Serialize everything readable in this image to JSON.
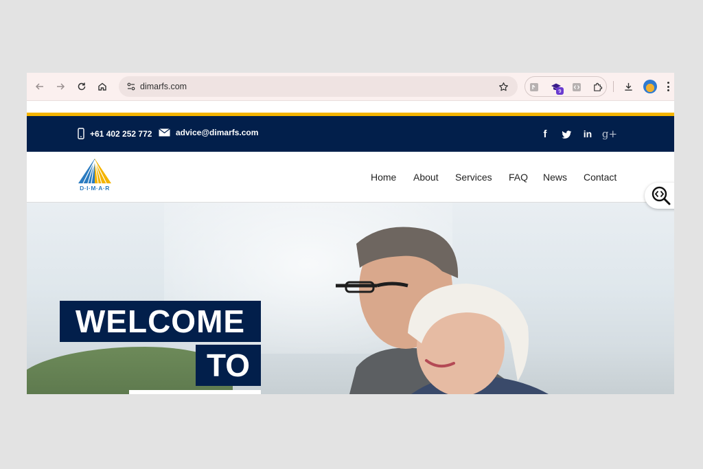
{
  "browser": {
    "url": "dimarfs.com",
    "extension_badge": "9"
  },
  "site": {
    "topbar": {
      "phone": "+61 402 252 772",
      "email": "advice@dimarfs.com",
      "social": [
        {
          "icon": "facebook-icon",
          "glyph": "f"
        },
        {
          "icon": "twitter-icon"
        },
        {
          "icon": "linkedin-icon",
          "glyph": "in"
        },
        {
          "icon": "google-plus-icon",
          "glyph": "g+"
        }
      ]
    },
    "logo_text": "D·I·M·A·R",
    "nav": [
      "Home",
      "About",
      "Services",
      "FAQ",
      "News",
      "Contact"
    ],
    "hero": {
      "line1": "WELCOME",
      "line2": "TO"
    }
  },
  "colors": {
    "navy": "#021f4b",
    "gold": "#f4b400",
    "logo_blue": "#2a7bc0"
  }
}
